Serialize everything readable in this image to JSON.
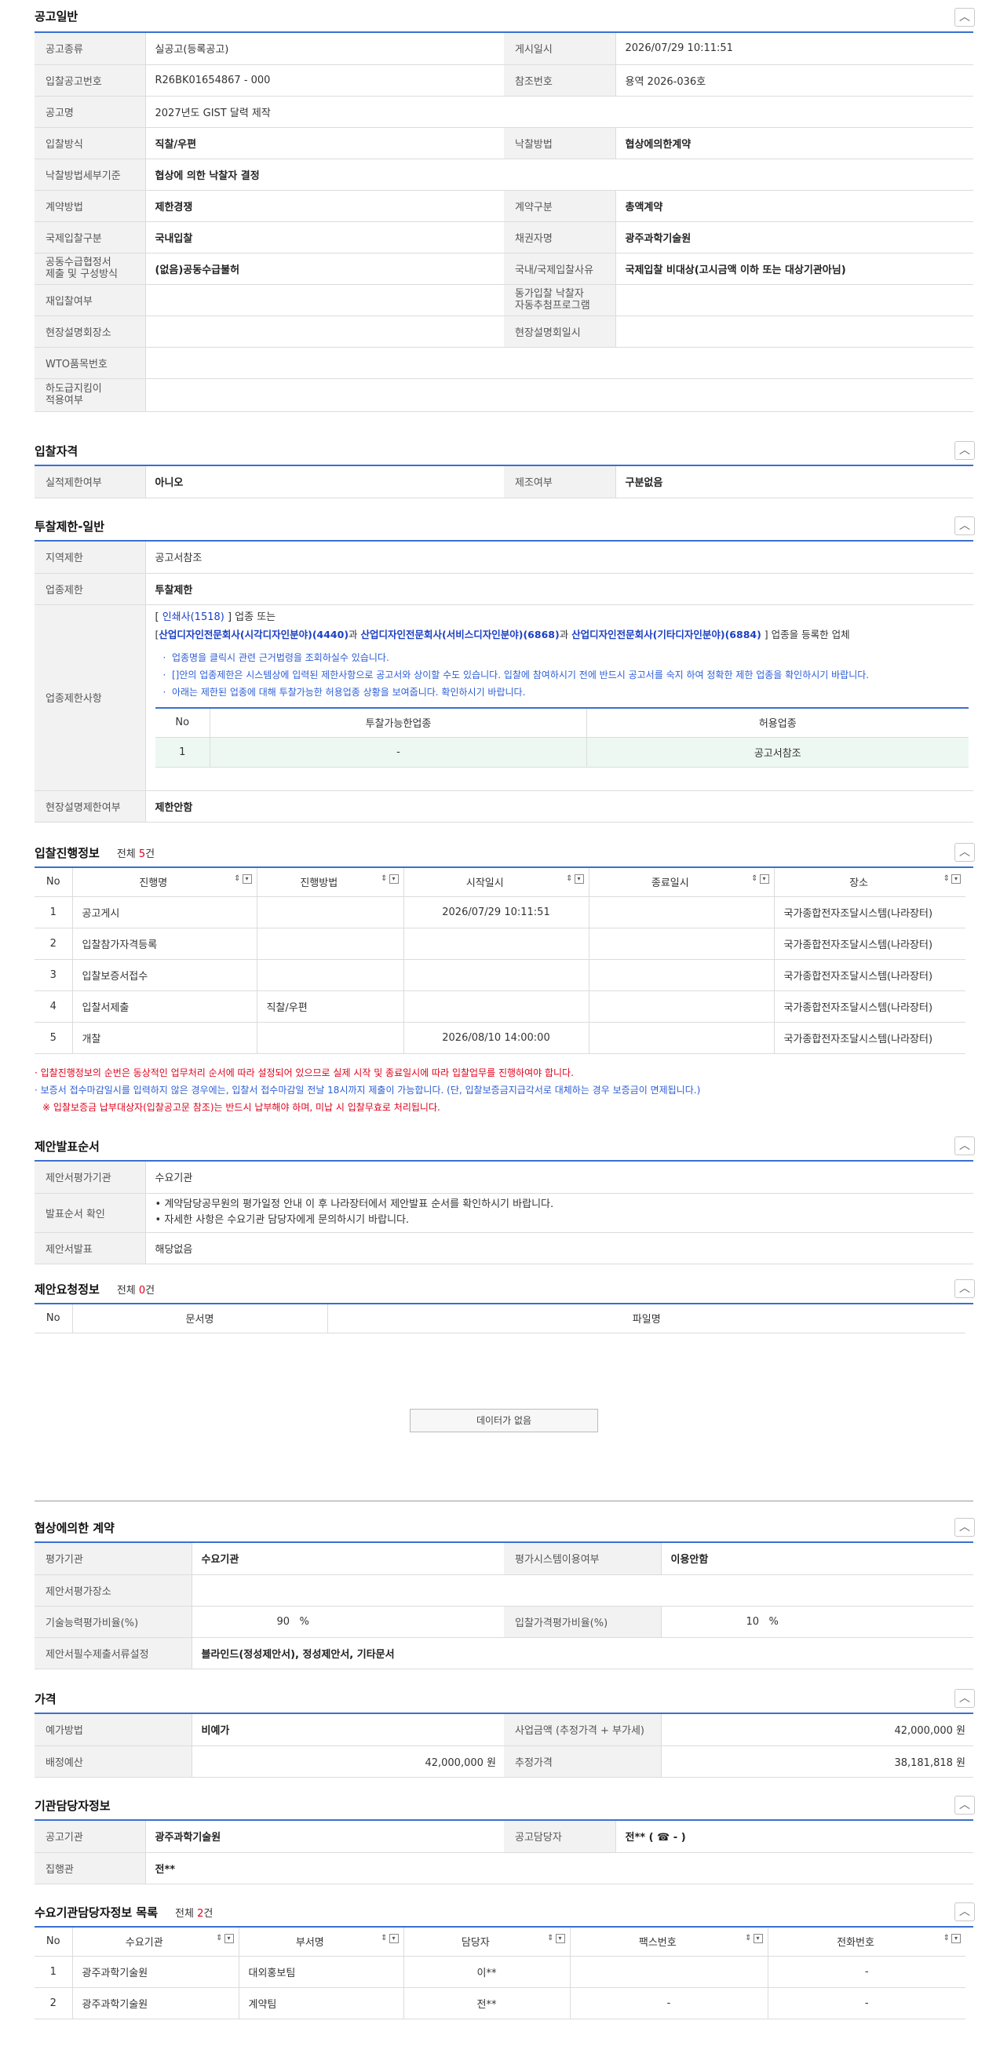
{
  "sections": {
    "general": {
      "title": "공고일반",
      "rows": [
        {
          "l1": "공고종류",
          "v1": "실공고(등록공고)",
          "l2": "게시일시",
          "v2": "2026/07/29 10:11:51"
        },
        {
          "l1": "입찰공고번호",
          "v1": "R26BK01654867 - 000",
          "l2": "참조번호",
          "v2": "용역 2026-036호"
        },
        {
          "l1": "공고명",
          "v1": "2027년도 GIST 달력 제작"
        },
        {
          "l1": "입찰방식",
          "v1": "직찰/우편",
          "l2": "낙찰방법",
          "v2": "협상에의한계약"
        },
        {
          "l1": "낙찰방법세부기준",
          "v1": "협상에 의한 낙찰자 결정"
        },
        {
          "l1": "계약방법",
          "v1": "제한경쟁",
          "l2": "계약구분",
          "v2": "총액계약"
        },
        {
          "l1": "국제입찰구분",
          "v1": "국내입찰",
          "l2": "채권자명",
          "v2": "광주과학기술원"
        },
        {
          "l1": "공동수급협정서\n제출 및 구성방식",
          "v1": "(없음)공동수급불허",
          "l2": "국내/국제입찰사유",
          "v2": "국제입찰 비대상(고시금액 이하 또는 대상기관아님)"
        },
        {
          "l1": "재입찰여부",
          "v1": "",
          "l2": "동가입찰 낙찰자\n자동추첨프로그램",
          "v2": ""
        },
        {
          "l1": "현장설명회장소",
          "v1": "",
          "l2": "현장설명회일시",
          "v2": ""
        },
        {
          "l1": "WTO품목번호",
          "v1": ""
        },
        {
          "l1": "하도급지킴이\n적용여부",
          "v1": ""
        }
      ]
    },
    "qualification": {
      "title": "입찰자격",
      "rows": [
        {
          "l1": "실적제한여부",
          "v1": "아니오",
          "l2": "제조여부",
          "v2": "구분없음"
        }
      ]
    },
    "restriction": {
      "title": "투찰제한-일반",
      "region_label": "지역제한",
      "region_value": "공고서참조",
      "industry_label": "업종제한",
      "industry_value": "투찰제한",
      "detail_label": "업종제한사항",
      "line1_a": "[ ",
      "line1_link": "인쇄사(1518)",
      "line1_b": " ] 업종 또는",
      "line2_link1": "산업디자인전문회사(시각디자인분야)(4440)",
      "line2_and1": "과 ",
      "line2_link2": "산업디자인전문회사(서비스디자인분야)(6868)",
      "line2_and2": "과 ",
      "line2_link3": "산업디자인전문회사(기타디자인분야)(6884)",
      "line2_end": " ] 업종을 등록한 업체",
      "notes": [
        "업종명을 클릭시 관련 근거법령을 조회하실수 있습니다.",
        "[]안의 업종제한은 시스템상에 입력된 제한사항으로 공고서와 상이할 수도 있습니다. 입찰에 참여하시기 전에 반드시 공고서를 숙지 하여 정확한 제한 업종을 확인하시기 바랍니다.",
        "아래는 제한된 업종에 대해 투찰가능한 허용업종 상황을 보여줍니다. 확인하시기 바랍니다."
      ],
      "sub_headers": [
        "No",
        "투찰가능한업종",
        "허용업종"
      ],
      "sub_row": [
        "1",
        "-",
        "공고서참조"
      ],
      "site_label": "현장설명제한여부",
      "site_value": "제한안함"
    },
    "progress": {
      "title": "입찰진행정보",
      "count_prefix": "전체 ",
      "count": "5",
      "count_suffix": "건",
      "headers": [
        "No",
        "진행명",
        "진행방법",
        "시작일시",
        "종료일시",
        "장소"
      ],
      "rows": [
        [
          "1",
          "공고게시",
          "",
          "2026/07/29 10:11:51",
          "",
          "국가종합전자조달시스템(나라장터)"
        ],
        [
          "2",
          "입찰참가자격등록",
          "",
          "",
          "",
          "국가종합전자조달시스템(나라장터)"
        ],
        [
          "3",
          "입찰보증서접수",
          "",
          "",
          "",
          "국가종합전자조달시스템(나라장터)"
        ],
        [
          "4",
          "입찰서제출",
          "직찰/우편",
          "",
          "",
          "국가종합전자조달시스템(나라장터)"
        ],
        [
          "5",
          "개찰",
          "",
          "2026/08/10 14:00:00",
          "",
          "국가종합전자조달시스템(나라장터)"
        ]
      ],
      "note1": "입찰진행정보의 순번은 동상적인 업무처리 순서에 따라 설정되어 있으므로 실제 시작 및 종료일시에 따라 입찰업무를 진행하여야 합니다.",
      "note2": "보증서 접수마감일시를 입력하지 않은 경우에는, 입찰서 접수마감일 전날 18시까지 제출이 가능합니다. (단, 입찰보증금지급각서로 대체하는 경우 보증금이 면제됩니다.)",
      "note3": "※ 입찰보증금 납부대상자(입찰공고문 참조)는 반드시 납부해야 하며, 미납 시 입찰무효로 처리됩니다."
    },
    "presentation": {
      "title": "제안발표순서",
      "eval_label": "제안서평가기관",
      "eval_value": "수요기관",
      "order_label": "발표순서 확인",
      "order_lines": [
        "계약담당공무원의 평가일정 안내 이 후 나라장터에서 제안발표 순서를 확인하시기 바랍니다.",
        "자세한 사항은 수요기관 담당자에게 문의하시기 바랍니다."
      ],
      "present_label": "제안서발표",
      "present_value": "해당없음"
    },
    "request": {
      "title": "제안요청정보",
      "count_prefix": "전체 ",
      "count": "0",
      "count_suffix": "건",
      "headers": [
        "No",
        "문서명",
        "파일명"
      ],
      "empty": "데이터가 없음"
    },
    "negotiation": {
      "title": "협상에의한 계약",
      "rows": [
        {
          "l1": "평가기관",
          "v1": "수요기관",
          "l2": "평가시스템이용여부",
          "v2": "이용안함"
        },
        {
          "l1": "제안서평가장소",
          "v1": ""
        },
        {
          "l1": "기술능력평가비율(%)",
          "v1": "90",
          "u1": "%",
          "l2": "입찰가격평가비율(%)",
          "v2": "10",
          "u2": "%"
        },
        {
          "l1": "제안서필수제출서류설정",
          "v1": "블라인드(정성제안서), 정성제안서, 기타문서"
        }
      ]
    },
    "price": {
      "title": "가격",
      "rows": [
        {
          "l1": "예가방법",
          "v1": "비예가",
          "l2": "사업금액 (추정가격 + 부가세)",
          "v2": "42,000,000 원"
        },
        {
          "l1": "배정예산",
          "v1": "42,000,000 원",
          "l2": "추정가격",
          "v2": "38,181,818 원"
        }
      ]
    },
    "contact": {
      "title": "기관담당자정보",
      "rows": [
        {
          "l1": "공고기관",
          "v1": "광주과학기술원",
          "l2": "공고담당자",
          "v2": "전** ( ☎ - )"
        },
        {
          "l1": "집행관",
          "v1": "전**"
        }
      ]
    },
    "demand": {
      "title": "수요기관담당자정보 목록",
      "count_prefix": "전체 ",
      "count": "2",
      "count_suffix": "건",
      "headers": [
        "No",
        "수요기관",
        "부서명",
        "담당자",
        "팩스번호",
        "전화번호"
      ],
      "rows": [
        [
          "1",
          "광주과학기술원",
          "대외홍보팀",
          "이**",
          "",
          "-"
        ],
        [
          "2",
          "광주과학기술원",
          "계약팀",
          "전**",
          "-",
          "-"
        ]
      ]
    }
  },
  "icons": {
    "collapse": "chevron-up-icon",
    "sort": "sort-icon",
    "dropdown": "dropdown-icon"
  },
  "colors": {
    "accent": "#3a70d0",
    "header_bg": "#f2f2f2",
    "alert": "#e0001b",
    "link": "#1b3fc4",
    "note": "#2b5dd8",
    "highlight_row": "#eef8f3"
  }
}
